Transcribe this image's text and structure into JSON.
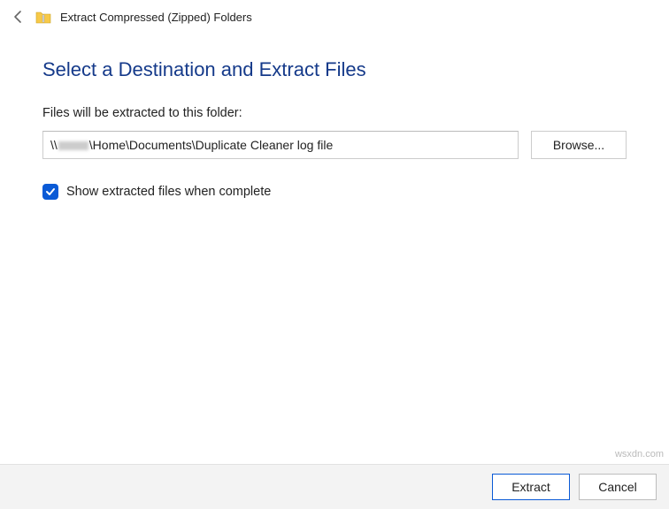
{
  "header": {
    "title": "Extract Compressed (Zipped) Folders"
  },
  "main": {
    "heading": "Select a Destination and Extract Files",
    "sub_label": "Files will be extracted to this folder:",
    "path_prefix": "\\\\",
    "path_suffix": "\\Home\\Documents\\Duplicate Cleaner log file",
    "browse_label": "Browse...",
    "checkbox_label": "Show extracted files when complete",
    "checkbox_checked": true
  },
  "footer": {
    "extract_label": "Extract",
    "cancel_label": "Cancel"
  },
  "watermark": "wsxdn.com"
}
